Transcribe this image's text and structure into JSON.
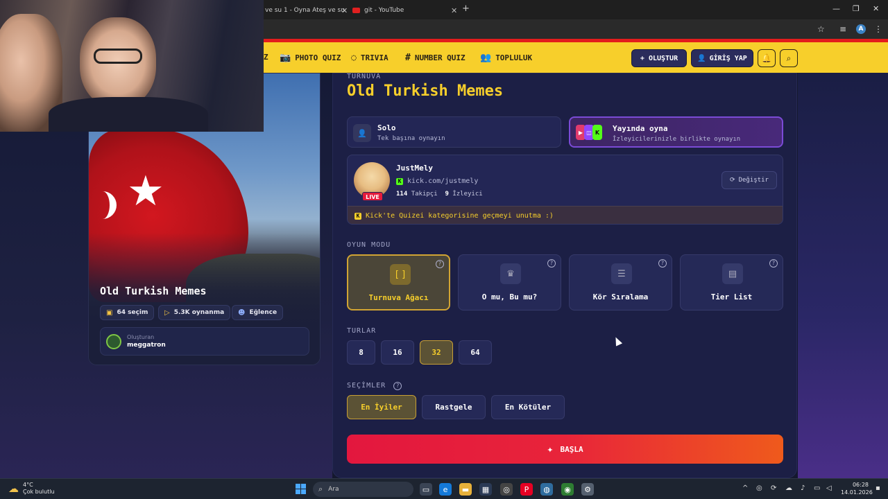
{
  "browser": {
    "tabs": [
      {
        "label": "ve su 1 - Oyna Ateş ve su"
      },
      {
        "label": "git - YouTube"
      }
    ],
    "profile_initial": "A"
  },
  "header": {
    "nav": [
      {
        "label": "Z",
        "icon": ""
      },
      {
        "label": "PHOTO QUIZ",
        "icon": "camera-icon"
      },
      {
        "label": "TRIVIA",
        "icon": "chat-icon"
      },
      {
        "label": "NUMBER QUIZ",
        "icon": "hash-icon"
      },
      {
        "label": "TOPLULUK",
        "icon": "users-icon"
      }
    ],
    "create_label": "+ OLUŞTUR",
    "login_label": "GİRİŞ YAP"
  },
  "left_card": {
    "title": "Old Turkish Memes",
    "chips": [
      {
        "icon": "images-icon",
        "label": "64 seçim"
      },
      {
        "icon": "play-icon",
        "label": "5.3K oynanma"
      },
      {
        "icon": "mask-icon",
        "label": "Eğlence"
      }
    ],
    "creator_label": "Oluşturan",
    "creator_name": "meggatron"
  },
  "main": {
    "eyebrow": "TURNUVA",
    "title": "Old Turkish Memes",
    "modes": [
      {
        "title": "Solo",
        "subtitle": "Tek başına oynayın"
      },
      {
        "title": "Yayında oyna",
        "subtitle": "İzleyicilerinizle birlikte oynayın"
      }
    ],
    "streamer": {
      "name": "JustMely",
      "link": "kick.com/justmely",
      "followers": "114",
      "followers_label": "Takipçi",
      "viewers": "9",
      "viewers_label": "İzleyici",
      "live_label": "LIVE",
      "change_label": "Değiştir",
      "notice": "Kick'te Quizei kategorisine geçmeyi unutma :)"
    },
    "game_mode_label": "OYUN MODU",
    "game_modes": [
      {
        "label": "Turnuva Ağacı",
        "icon": "bracket-icon"
      },
      {
        "label": "O mu, Bu mu?",
        "icon": "crown-icon"
      },
      {
        "label": "Kör Sıralama",
        "icon": "list-icon"
      },
      {
        "label": "Tier List",
        "icon": "tiers-icon"
      }
    ],
    "rounds_label": "TURLAR",
    "rounds": [
      "8",
      "16",
      "32",
      "64"
    ],
    "selections_label": "SEÇİMLER",
    "selections": [
      "En İyiler",
      "Rastgele",
      "En Kötüler"
    ],
    "start_label": "BAŞLA"
  },
  "taskbar": {
    "temp": "4°C",
    "weather": "Çok bulutlu",
    "search_placeholder": "Ara",
    "time": "06:28",
    "date": "14.01.2026"
  }
}
